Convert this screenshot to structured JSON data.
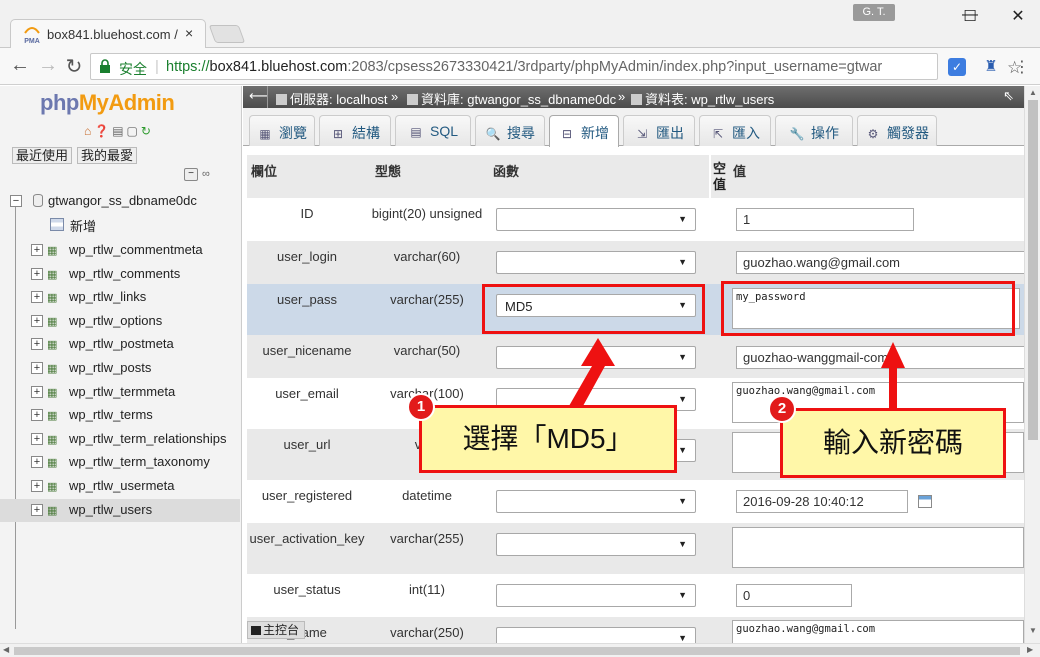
{
  "browser": {
    "tab_title": "box841.bluehost.com /",
    "favicon_text": "PMA",
    "close_glyph": "×",
    "user_badge": "G. T.",
    "secure_label": "安全",
    "url_scheme": "https://",
    "url_host": "box841.bluehost.com",
    "url_rest": ":2083/cpsess2673330421/3rdparty/phpMyAdmin/index.php?input_username=gtwar",
    "controls": {
      "minimize": "—",
      "maximize": "☐",
      "close": "✕"
    }
  },
  "sidebar": {
    "logo_php": "php",
    "logo_myadmin": "MyAdmin",
    "recent_tab": "最近使用",
    "favorites_tab": "我的最愛",
    "database": "gtwangor_ss_dbname0dc",
    "new_item": "新增",
    "tables": [
      "wp_rtlw_commentmeta",
      "wp_rtlw_comments",
      "wp_rtlw_links",
      "wp_rtlw_options",
      "wp_rtlw_postmeta",
      "wp_rtlw_posts",
      "wp_rtlw_termmeta",
      "wp_rtlw_terms",
      "wp_rtlw_term_relationships",
      "wp_rtlw_term_taxonomy",
      "wp_rtlw_usermeta",
      "wp_rtlw_users"
    ],
    "active_table": "wp_rtlw_users"
  },
  "breadcrumb": {
    "server": "伺服器: localhost",
    "database": "資料庫: gtwangor_ss_dbname0dc",
    "table": "資料表: wp_rtlw_users"
  },
  "tabs": [
    {
      "label": "瀏覽",
      "icon": "browse-icon"
    },
    {
      "label": "結構",
      "icon": "structure-icon"
    },
    {
      "label": "SQL",
      "icon": "sql-icon"
    },
    {
      "label": "搜尋",
      "icon": "search-icon"
    },
    {
      "label": "新增",
      "icon": "insert-icon",
      "active": true
    },
    {
      "label": "匯出",
      "icon": "export-icon"
    },
    {
      "label": "匯入",
      "icon": "import-icon"
    },
    {
      "label": "操作",
      "icon": "operations-icon"
    },
    {
      "label": "觸發器",
      "icon": "triggers-icon"
    }
  ],
  "grid": {
    "headers": {
      "column": "欄位",
      "type": "型態",
      "function": "函數",
      "null": "空值",
      "value": "值"
    },
    "rows": [
      {
        "name": "ID",
        "type": "bigint(20) unsigned",
        "function": "",
        "value": "1"
      },
      {
        "name": "user_login",
        "type": "varchar(60)",
        "function": "",
        "value": "guozhao.wang@gmail.com"
      },
      {
        "name": "user_pass",
        "type": "varchar(255)",
        "function": "MD5",
        "value": "my_password"
      },
      {
        "name": "user_nicename",
        "type": "varchar(50)",
        "function": "",
        "value": "guozhao-wanggmail-com"
      },
      {
        "name": "user_email",
        "type": "varchar(100)",
        "function": "",
        "value": "guozhao.wang@gmail.com"
      },
      {
        "name": "user_url",
        "type": "varc",
        "function": "",
        "value": ""
      },
      {
        "name": "user_registered",
        "type": "datetime",
        "function": "",
        "value": "2016-09-28 10:40:12"
      },
      {
        "name": "user_activation_key",
        "type": "varchar(255)",
        "function": "",
        "value": ""
      },
      {
        "name": "user_status",
        "type": "int(11)",
        "function": "",
        "value": "0"
      },
      {
        "name": "_name",
        "type": "varchar(250)",
        "function": "",
        "value": "guozhao.wang@gmail.com"
      }
    ]
  },
  "console_label": "主控台",
  "annotations": {
    "step1_num": "1",
    "step1_text": "選擇「MD5」",
    "step2_num": "2",
    "step2_text": "輸入新密碼",
    "highlight_color": "#ee1111",
    "callout_color": "#fff7a8"
  }
}
